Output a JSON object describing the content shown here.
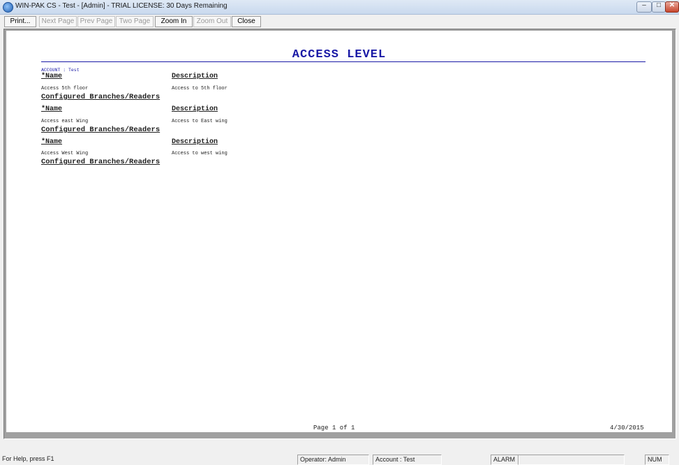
{
  "window": {
    "title": "WIN-PAK CS - Test - [Admin] - TRIAL LICENSE: 30 Days Remaining",
    "controls": {
      "minimize": "–",
      "maximize": "□",
      "close": "✕"
    }
  },
  "toolbar": {
    "print": "Print...",
    "next_page": "Next Page",
    "prev_page": "Prev Page",
    "two_page": "Two Page",
    "zoom_in": "Zoom In",
    "zoom_out": "Zoom Out",
    "close": "Close"
  },
  "report": {
    "title": "ACCESS LEVEL",
    "account": "ACCOUNT : Test",
    "name_header": "*Name",
    "description_header": "Description",
    "configured_header": "Configured Branches/Readers",
    "rows": [
      {
        "name": "Access 5th floor",
        "description": "Access to 5th floor"
      },
      {
        "name": "Access east Wing",
        "description": "Access to East wing"
      },
      {
        "name": "Access West Wing",
        "description": "Access to west wing"
      }
    ],
    "page_label": "Page 1 of 1",
    "date": "4/30/2015"
  },
  "statusbar": {
    "help": "For Help, press F1",
    "operator": "Operator: Admin",
    "account": "Account : Test",
    "alarm": "ALARM",
    "num": "NUM"
  }
}
